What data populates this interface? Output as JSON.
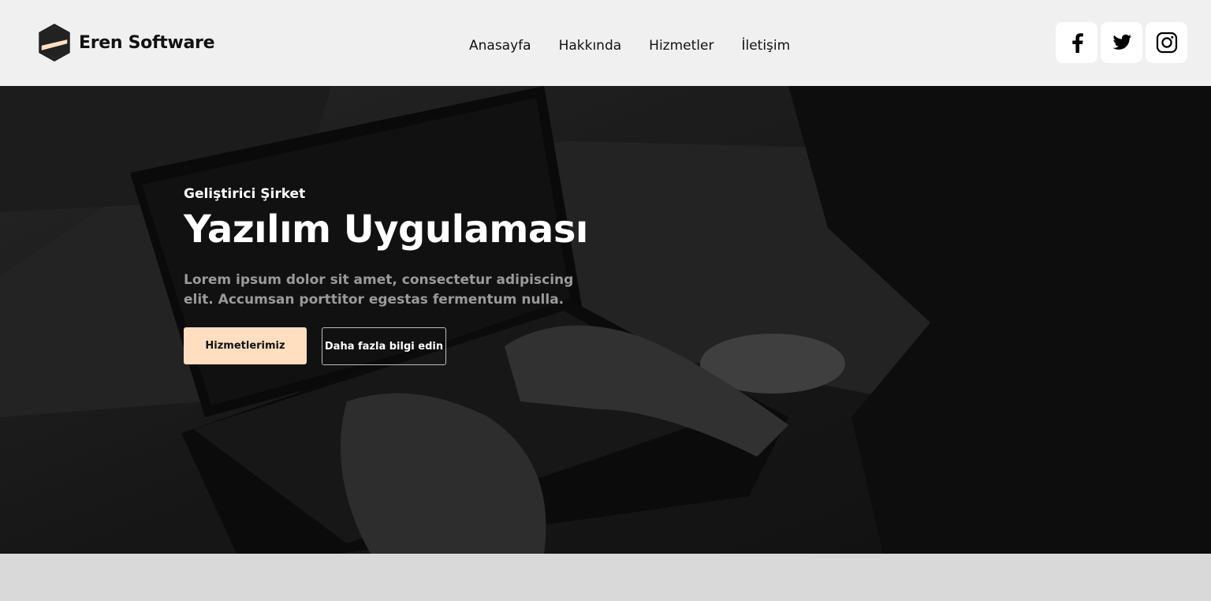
{
  "brand": {
    "name": "Eren Software",
    "logo_icon": "hexagon-s-logo-icon",
    "accent": "#ffdfbf"
  },
  "nav": {
    "items": [
      {
        "label": "Anasayfa"
      },
      {
        "label": "Hakkında"
      },
      {
        "label": "Hizmetler"
      },
      {
        "label": "İletişim"
      }
    ]
  },
  "social": {
    "items": [
      {
        "icon": "facebook-icon"
      },
      {
        "icon": "twitter-icon"
      },
      {
        "icon": "instagram-icon"
      }
    ]
  },
  "hero": {
    "eyebrow": "Geliştirici Şirket",
    "title": "Yazılım Uygulaması",
    "text": "Lorem ipsum dolor sit amet, consectetur adipiscing elit. Accumsan porttitor egestas fermentum nulla.",
    "primary_button": "Hizmetlerimiz",
    "secondary_button": "Daha fazla bilgi edin"
  },
  "colors": {
    "header_bg": "#f0f0f0",
    "hero_overlay": "#161616",
    "primary_button_bg": "#ffdfbf"
  }
}
